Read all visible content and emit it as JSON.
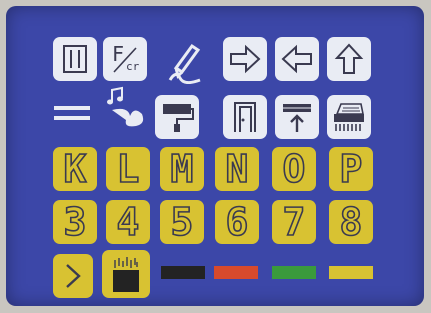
{
  "toolbar_icons": [
    "list-icon",
    "font-cr-icon",
    "pen-icon",
    "arrow-right-icon",
    "arrow-left-icon",
    "arrow-up-icon",
    "equals-icon",
    "music-note-icon",
    "paint-roller-icon",
    "door-icon",
    "upload-tray-icon",
    "printer-icon"
  ],
  "font_label": {
    "main": "F",
    "sub": "cr"
  },
  "letter_keys": [
    "K",
    "L",
    "M",
    "N",
    "O",
    "P"
  ],
  "digit_keys": [
    "3",
    "4",
    "5",
    "6",
    "7",
    "8"
  ],
  "bottom_row": {
    "next_icon": "chevron-right-icon",
    "fill_icon": "fill-bucket-icon"
  },
  "color_swatches": [
    "#232323",
    "#d84a2c",
    "#3a9a3c",
    "#d8c232"
  ],
  "colors": {
    "screen": "#3c47a8",
    "key_white": "#e9ecf4",
    "key_yellow": "#d8c232",
    "outline": "#3a3a50"
  }
}
